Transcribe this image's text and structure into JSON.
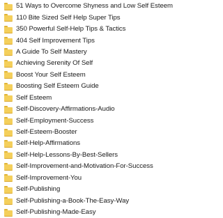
{
  "folders": [
    {
      "name": "51 Ways to Overcome Shyness and Low Self Esteem",
      "icon": "folder-icon"
    },
    {
      "name": "110 Bite Sized Self Help Super Tips",
      "icon": "folder-icon"
    },
    {
      "name": "350 Powerful Self-Help Tips & Tactics",
      "icon": "folder-icon"
    },
    {
      "name": "404 Self Improvement Tips",
      "icon": "folder-icon"
    },
    {
      "name": "A Guide To Self Mastery",
      "icon": "folder-icon"
    },
    {
      "name": "Achieving Serenity Of Self",
      "icon": "folder-icon"
    },
    {
      "name": "Boost Your Self Esteem",
      "icon": "folder-icon"
    },
    {
      "name": "Boosting Self Esteem Guide",
      "icon": "folder-icon"
    },
    {
      "name": "Self Esteem",
      "icon": "folder-icon"
    },
    {
      "name": "Self-Discovery-Affirmations-Audio",
      "icon": "folder-icon"
    },
    {
      "name": "Self-Employment-Success",
      "icon": "folder-icon"
    },
    {
      "name": "Self-Esteem-Booster",
      "icon": "folder-icon"
    },
    {
      "name": "Self-Help-Affirmations",
      "icon": "folder-icon"
    },
    {
      "name": "Self-Help-Lessons-By-Best-Sellers",
      "icon": "folder-icon"
    },
    {
      "name": "Self-Improvement-and-Motivation-For-Success",
      "icon": "folder-icon"
    },
    {
      "name": "Self-Improvement-You",
      "icon": "folder-icon"
    },
    {
      "name": "Self-Publishing",
      "icon": "folder-icon"
    },
    {
      "name": "Self-Publishing-a-Book-The-Easy-Way",
      "icon": "folder-icon"
    },
    {
      "name": "Self-Publishing-Made-Easy",
      "icon": "folder-icon"
    }
  ],
  "colors": {
    "folder": "#f4cf5b",
    "folder_dark": "#e0b437",
    "text": "#1a1a1a",
    "background": "#ffffff"
  }
}
